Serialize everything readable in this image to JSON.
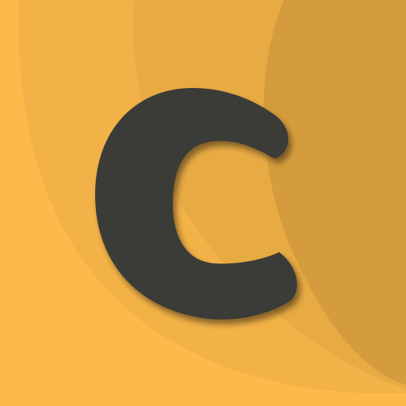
{
  "logo": {
    "letter": "C"
  },
  "colors": {
    "background": "#fdb94a",
    "band_1": "#f2b247",
    "band_2": "#e8aa43",
    "band_3": "#d59c3d",
    "letter": "#3a3a38",
    "letter_shadow": "#9c6a1c"
  },
  "icons": [
    "letter-c-logo-icon"
  ]
}
